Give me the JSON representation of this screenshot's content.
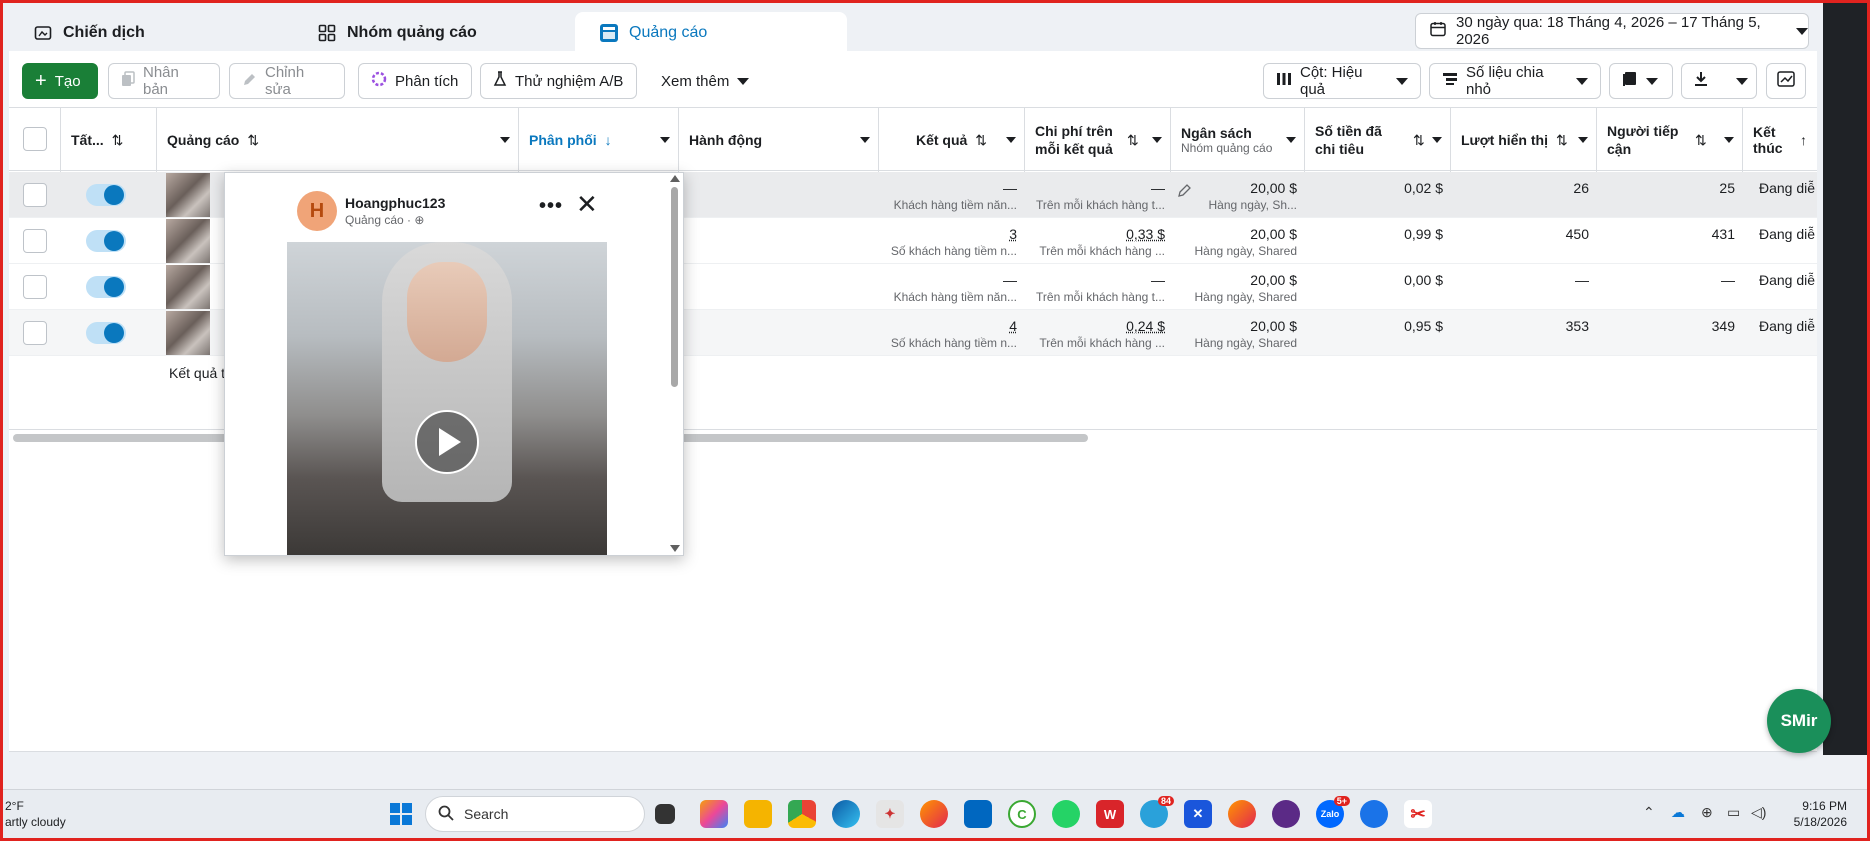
{
  "tabs": [
    {
      "label": "Chiến dịch",
      "icon": "folder-icon"
    },
    {
      "label": "Nhóm quảng cáo",
      "icon": "grid-icon"
    },
    {
      "label": "Quảng cáo",
      "icon": "ad-icon"
    }
  ],
  "date_range": "30 ngày qua: 18 Tháng 4, 2026 – 17 Tháng 5, 2026",
  "toolbar": {
    "create": "Tạo",
    "duplicate": "Nhân bản",
    "edit": "Chỉnh sửa",
    "analyze": "Phân tích",
    "ab_test": "Thử nghiệm A/B",
    "more": "Xem thêm",
    "columns": "Cột: Hiệu quả",
    "breakdown": "Số liệu chia nhỏ"
  },
  "columns": {
    "all": "Tất...",
    "ad": "Quảng cáo",
    "delivery": "Phân phối",
    "actions": "Hành động",
    "results": "Kết quả",
    "cost_per_result": "Chi phí trên mỗi kết quả",
    "budget": "Ngân sách",
    "budget_sub": "Nhóm quảng cáo",
    "amount_spent": "Số tiền đã chi tiêu",
    "impressions": "Lượt hiển thị",
    "reach": "Người tiếp cận",
    "end": "Kết thúc"
  },
  "rows": [
    {
      "result": "—",
      "result_sub": "Khách hàng tiềm năn...",
      "cpr": "—",
      "cpr_sub": "Trên mỗi khách hàng t...",
      "budget": "20,00 $",
      "budget_sub": "Hàng ngày, Sh...",
      "spent": "0,02 $",
      "impressions": "26",
      "reach": "25",
      "status": "Đang diễ"
    },
    {
      "result": "3",
      "result_sub": "Số khách hàng tiềm n...",
      "cpr": "0,33 $",
      "cpr_sub": "Trên mỗi khách hàng ...",
      "budget": "20,00 $",
      "budget_sub": "Hàng ngày, Shared",
      "spent": "0,99 $",
      "impressions": "450",
      "reach": "431",
      "status": "Đang diễ"
    },
    {
      "result": "—",
      "result_sub": "Khách hàng tiềm năn...",
      "cpr": "—",
      "cpr_sub": "Trên mỗi khách hàng t...",
      "budget": "20,00 $",
      "budget_sub": "Hàng ngày, Shared",
      "spent": "0,00 $",
      "impressions": "—",
      "reach": "—",
      "status": "Đang diễ"
    },
    {
      "result": "4",
      "result_sub": "Số khách hàng tiềm n...",
      "cpr": "0,24 $",
      "cpr_sub": "Trên mỗi khách hàng ...",
      "budget": "20,00 $",
      "budget_sub": "Hàng ngày, Shared",
      "spent": "0,95 $",
      "impressions": "353",
      "reach": "349",
      "status": "Đang diễ"
    }
  ],
  "footer_text": "Kết quả t",
  "preview": {
    "avatar_letter": "H",
    "page_name": "Hoangphuc123",
    "sponsored": "Quảng cáo · ⊕"
  },
  "fab_label": "SMir",
  "taskbar": {
    "weather_temp": "2°F",
    "weather_desc": "artly cloudy",
    "search_placeholder": "Search",
    "time": "9:16 PM",
    "date": "5/18/2026",
    "badge_telegram": "84",
    "badge_zalo": "5+"
  },
  "colors": {
    "accent": "#0a78be",
    "create_green": "#1a7f37",
    "frame_red": "#e0231f"
  }
}
